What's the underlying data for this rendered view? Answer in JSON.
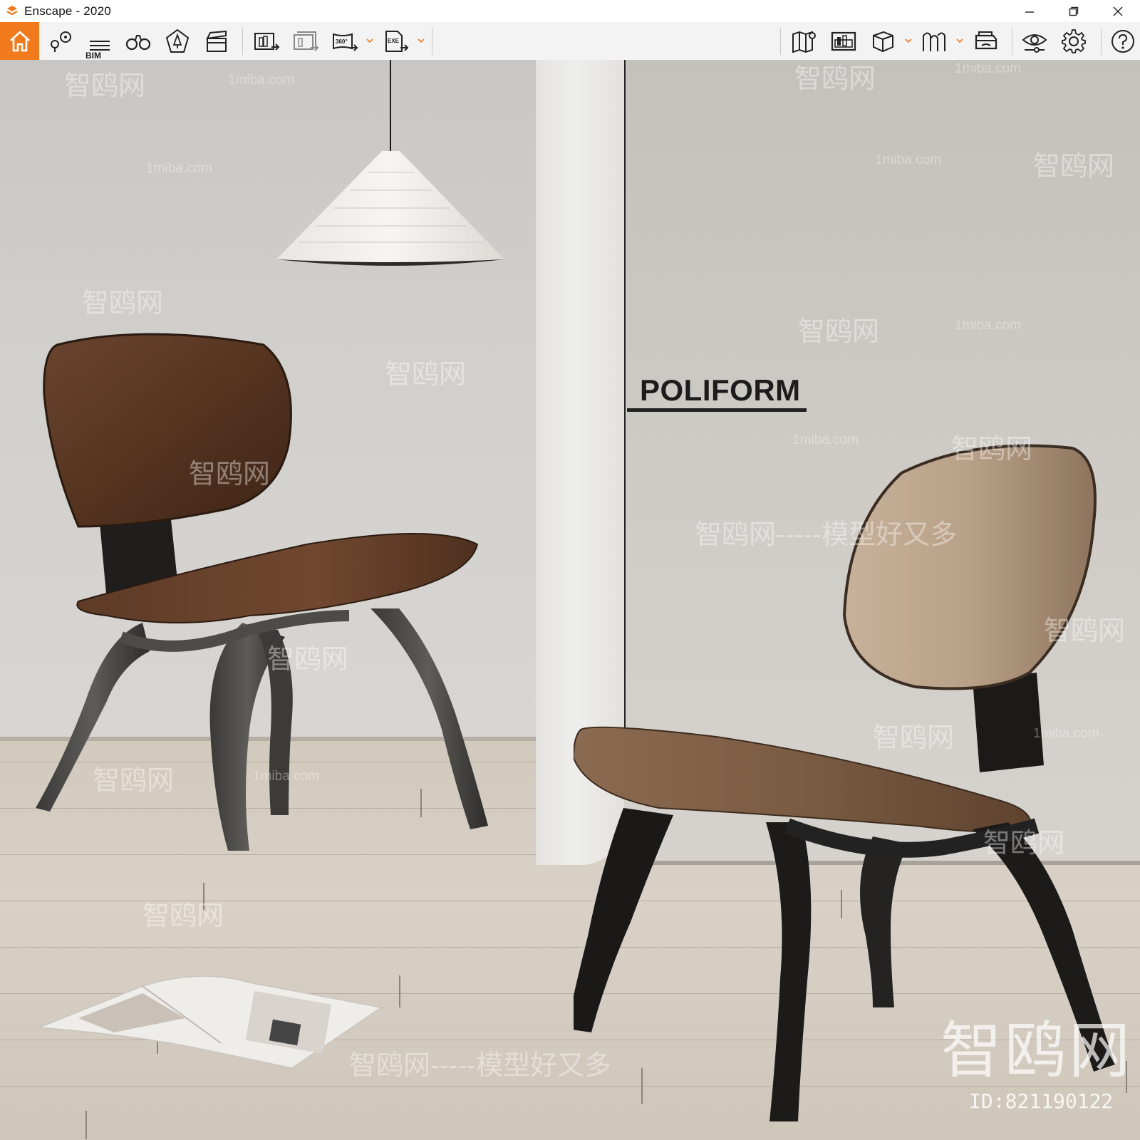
{
  "window": {
    "title": "Enscape - 2020",
    "controls": [
      "minimize-icon",
      "restore-icon",
      "close-icon"
    ]
  },
  "toolbar": {
    "accent_color": "#f07a1c",
    "left_tools": [
      {
        "name": "home-icon",
        "active": true
      },
      {
        "name": "views-icon"
      },
      {
        "name": "bim-icon",
        "label": "BIM"
      },
      {
        "name": "binoculars-icon"
      },
      {
        "name": "asset-library-icon"
      },
      {
        "name": "video-editor-icon"
      },
      {
        "name": "export-image-icon"
      },
      {
        "name": "batch-export-icon"
      },
      {
        "name": "panorama-360-icon",
        "label": "360°",
        "has_dropdown": true
      },
      {
        "name": "export-exe-icon",
        "label": "EXE",
        "has_dropdown": true
      }
    ],
    "right_tools": [
      {
        "name": "map-icon"
      },
      {
        "name": "minimap-icon"
      },
      {
        "name": "orthographic-cube-icon",
        "has_dropdown": true
      },
      {
        "name": "section-plane-icon",
        "has_dropdown": true
      },
      {
        "name": "vr-headset-icon"
      },
      {
        "name": "visual-settings-icon"
      },
      {
        "name": "settings-gear-icon"
      },
      {
        "name": "help-icon"
      }
    ],
    "collapse_icon": "chevron-up-icon"
  },
  "scene": {
    "brand_text": "POLIFORM",
    "watermark_site": "1miba.com",
    "watermark_cn": "智鸥网",
    "watermark_slogan": "智鸥网-----模型好又多",
    "watermark_big": "智鸥网",
    "watermark_id": "ID:821190122"
  }
}
